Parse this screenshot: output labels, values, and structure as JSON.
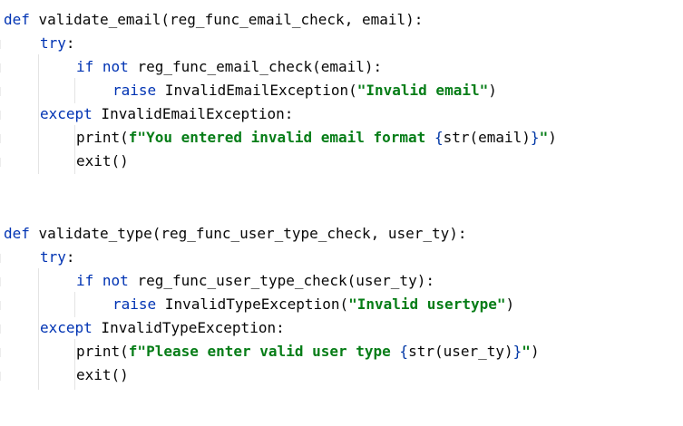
{
  "colors": {
    "background": "#ffffff",
    "keyword": "#0033b3",
    "string": "#067d17",
    "plain": "#080808",
    "indent_guide": "#e4e4e4"
  },
  "code": {
    "block1": {
      "line1": {
        "kw": "def",
        "rest": " validate_email(reg_func_email_check, email):"
      },
      "line2": {
        "kw": "try",
        "rest": ":"
      },
      "line3": {
        "kw1": "if",
        "kw2": "not",
        "rest": " reg_func_email_check(email):"
      },
      "line4": {
        "kw": "raise",
        "pre": " InvalidEmailException(",
        "str": "\"Invalid email\"",
        "post": ")"
      },
      "line5": {
        "kw": "except",
        "rest": " InvalidEmailException:"
      },
      "line6": {
        "fn": "print(",
        "str1": "f\"You entered invalid email format ",
        "brace_open": "{",
        "expr": "str(email)",
        "brace_close": "}",
        "str2": "\"",
        "post": ")"
      },
      "line7": {
        "text": "exit()"
      }
    },
    "block2": {
      "line1": {
        "kw": "def",
        "rest": " validate_type(reg_func_user_type_check, user_ty):"
      },
      "line2": {
        "kw": "try",
        "rest": ":"
      },
      "line3": {
        "kw1": "if",
        "kw2": "not",
        "rest": " reg_func_user_type_check(user_ty):"
      },
      "line4": {
        "kw": "raise",
        "pre": " InvalidTypeException(",
        "str": "\"Invalid usertype\"",
        "post": ")"
      },
      "line5": {
        "kw": "except",
        "rest": " InvalidTypeException:"
      },
      "line6": {
        "fn": "print(",
        "str1": "f\"Please enter valid user type ",
        "brace_open": "{",
        "expr": "str(user_ty)",
        "brace_close": "}",
        "str2": "\"",
        "post": ")"
      },
      "line7": {
        "text": "exit()"
      }
    }
  }
}
